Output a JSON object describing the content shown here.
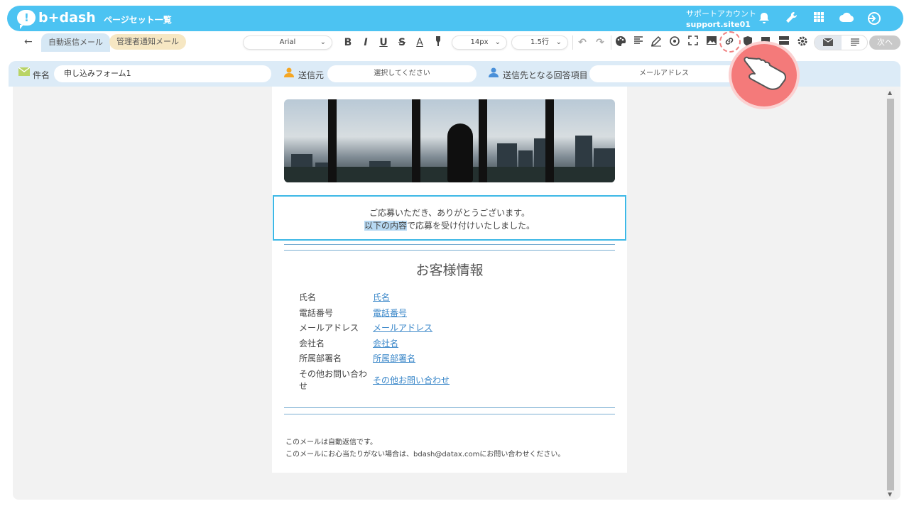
{
  "header": {
    "logo_text": "b+dash",
    "page_list_link": "ページセット一覧",
    "account_label": "サポートアカウント",
    "account_id": "support.site01",
    "icons": [
      "bell-icon",
      "wrench-icon",
      "grid-icon",
      "cloud-icon",
      "logout-icon"
    ]
  },
  "toolbar": {
    "back_icon": "arrow-left-icon",
    "tabs": [
      {
        "label": "自動返信メール"
      },
      {
        "label": "管理者通知メール"
      }
    ],
    "font_family": "Arial",
    "font_size": "14px",
    "line_height": "1.5行",
    "format_icons": [
      "bold-icon",
      "italic-icon",
      "underline-icon",
      "strikethrough-icon",
      "text-color-icon",
      "highlight-icon"
    ],
    "bold": "B",
    "italic": "I",
    "underline": "U",
    "strike": "S",
    "color_a": "A",
    "next_label": "次へ"
  },
  "fields": {
    "subject_label": "件名",
    "subject_value": "申し込みフォーム1",
    "sender_label": "送信元",
    "sender_placeholder": "選択してください",
    "recipient_label": "送信先となる回答項目",
    "recipient_value": "メールアドレス"
  },
  "mail": {
    "greeting_line1": "ご応募いただき、ありがとうございます。",
    "greeting_line2_hl": "以下の内容",
    "greeting_line2_rest": "で応募を受け付けいたしました。",
    "section_title": "お客様情報",
    "rows": [
      {
        "label": "氏名",
        "value": "氏名"
      },
      {
        "label": "電話番号",
        "value": "電話番号"
      },
      {
        "label": "メールアドレス",
        "value": "メールアドレス"
      },
      {
        "label": "会社名",
        "value": "会社名"
      },
      {
        "label": "所属部署名",
        "value": "所属部署名"
      },
      {
        "label": "その他お問い合わ",
        "label2": "せ",
        "value": "その他お問い合わせ"
      }
    ],
    "footer_line1": "このメールは自動返信です。",
    "footer_line2": "このメールにお心当たりがない場合は、bdash@datax.comにお問い合わせください。"
  },
  "colors": {
    "header_bg": "#4cc3f2",
    "field_bar_bg": "#dcebf7",
    "selection_border": "#3db8e6",
    "link": "#3a87c9",
    "pointer": "#f47a7a"
  }
}
